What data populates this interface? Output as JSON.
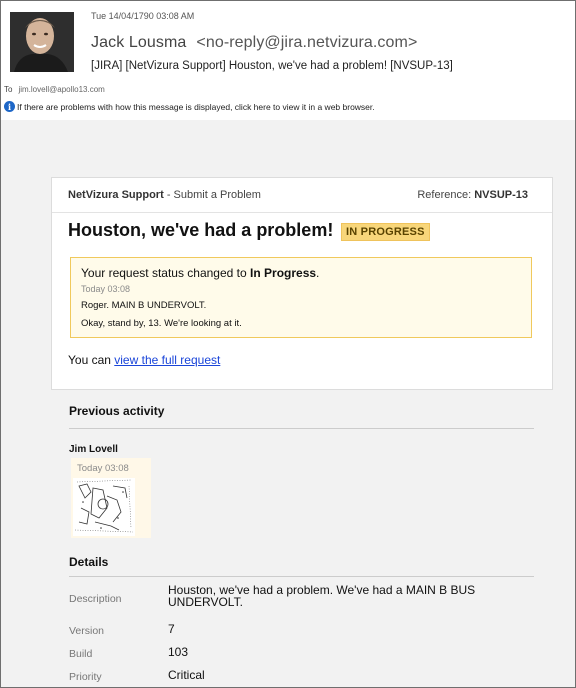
{
  "email": {
    "date": "Tue 14/04/1790 03:08 AM",
    "sender_name": "Jack Lousma",
    "sender_address": "<no-reply@jira.netvizura.com>",
    "subject": "[JIRA] [NetVizura Support] Houston, we've had a problem! [NVSUP-13]",
    "to_label": "To",
    "to_value": "jim.lovell@apollo13.com",
    "info_text": "If there are problems with how this message is displayed, click here to view it in a web browser."
  },
  "card": {
    "project": "NetVizura Support",
    "project_suffix": " - Submit a Problem",
    "reference_label": "Reference: ",
    "reference_value": "NVSUP-13",
    "title": "Houston, we've had a problem!",
    "status_badge": "IN PROGRESS",
    "notice_prefix": "Your request status changed to ",
    "notice_status": "In Progress",
    "notice_suffix": ".",
    "notice_time": "Today  03:08",
    "comment_line1": "Roger. MAIN B UNDERVOLT.",
    "comment_line2": "Okay, stand by, 13. We're looking at it.",
    "you_can": "You can ",
    "view_link": "view the full request"
  },
  "previous_activity": {
    "heading": "Previous activity",
    "actor": "Jim Lovell",
    "when": "Today  03:08"
  },
  "details": {
    "heading": "Details",
    "rows": [
      {
        "label": "Description",
        "value": "Houston, we've had a problem. We've had a MAIN B BUS UNDERVOLT."
      },
      {
        "label": "Version",
        "value": "7"
      },
      {
        "label": "Build",
        "value": "103"
      },
      {
        "label": "Priority",
        "value": "Critical"
      }
    ]
  },
  "colors": {
    "badge_bg": "#f8d67a",
    "notice_bg": "#fffbea",
    "link": "#1a45d9",
    "body_bg": "#f2f2f2"
  }
}
